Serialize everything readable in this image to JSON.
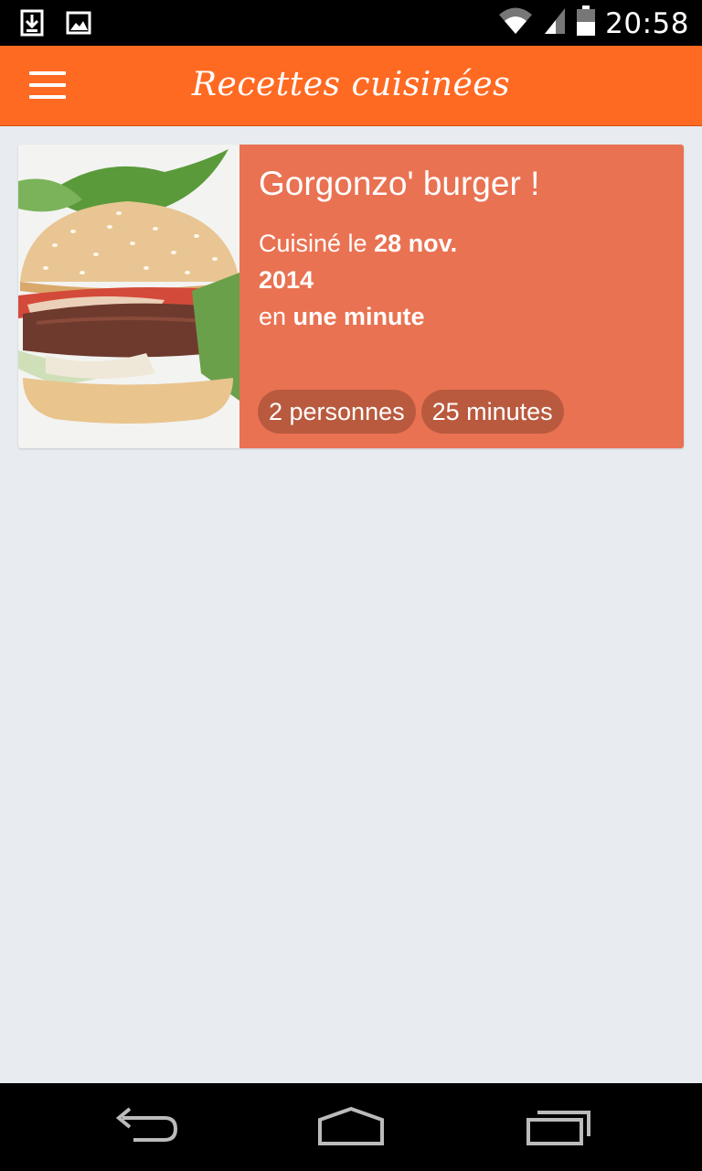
{
  "status_bar": {
    "time": "20:58",
    "icons": [
      "download-icon",
      "image-icon",
      "wifi-icon",
      "signal-icon",
      "battery-icon"
    ]
  },
  "app_bar": {
    "title": "Recettes cuisinées",
    "menu_icon": "hamburger-menu-icon"
  },
  "recipe": {
    "title": "Gorgonzo' burger !",
    "cooked_prefix": "Cuisiné le ",
    "cooked_date_line1": "28 nov.",
    "cooked_date_line2": "2014",
    "duration_prefix": "en ",
    "duration": "une minute",
    "tags": [
      "2 personnes",
      "25 minutes"
    ],
    "image": "burger-photo"
  },
  "nav_bar": {
    "buttons": [
      "back-icon",
      "home-icon",
      "recent-apps-icon"
    ]
  },
  "colors": {
    "app_bar": "#ff6a22",
    "card": "#e97252",
    "tag": "#b95a3f",
    "background": "#e8ecf1"
  }
}
